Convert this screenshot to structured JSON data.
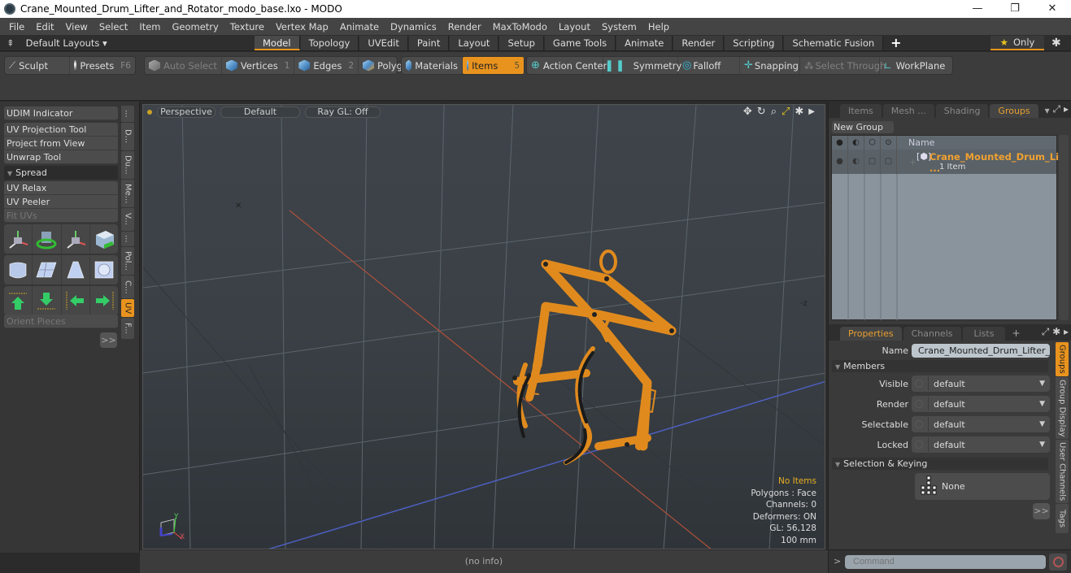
{
  "window": {
    "title": "Crane_Mounted_Drum_Lifter_and_Rotator_modo_base.lxo - MODO",
    "controls": {
      "minimize": "—",
      "maximize": "❐",
      "close": "✕"
    }
  },
  "menu": [
    "File",
    "Edit",
    "View",
    "Select",
    "Item",
    "Geometry",
    "Texture",
    "Vertex Map",
    "Animate",
    "Dynamics",
    "Render",
    "MaxToModo",
    "Layout",
    "System",
    "Help"
  ],
  "layoutbar": {
    "layouts_label": "Default Layouts ▾",
    "tabs": [
      {
        "label": "Model",
        "active": true
      },
      {
        "label": "Topology"
      },
      {
        "label": "UVEdit"
      },
      {
        "label": "Paint"
      },
      {
        "label": "Layout"
      },
      {
        "label": "Setup"
      },
      {
        "label": "Game Tools"
      },
      {
        "label": "Animate"
      },
      {
        "label": "Render"
      },
      {
        "label": "Scripting"
      },
      {
        "label": "Schematic Fusion"
      }
    ],
    "add_tab": "+",
    "only_label": "Only"
  },
  "toolbar": {
    "sculpt": "Sculpt",
    "presets": "Presets",
    "presets_key": "F6",
    "auto_select": "Auto Select",
    "vertices": "Vertices",
    "vertices_key": "1",
    "edges": "Edges",
    "edges_key": "2",
    "polygons": "Polygons",
    "materials": "Materials",
    "items": "Items",
    "items_key": "5",
    "action_center": "Action Center",
    "symmetry": "Symmetry",
    "falloff": "Falloff",
    "snapping": "Snapping",
    "select_through": "Select Through",
    "workplane": "WorkPlane"
  },
  "leftpanel": {
    "udim": "UDIM Indicator",
    "uv_projection": "UV Projection Tool",
    "project_from_view": "Project from View",
    "unwrap": "Unwrap Tool",
    "spread": "Spread",
    "uv_relax": "UV Relax",
    "uv_peeler": "UV Peeler",
    "fit_uvs": "Fit UVs",
    "orient_pieces": "Orient Pieces",
    "more": ">>",
    "vtabs": [
      "...",
      "D...",
      "Du...",
      "Me...",
      "V...",
      "...",
      "Pol...",
      "C...",
      "UV",
      "F..."
    ]
  },
  "viewport": {
    "view": "Perspective",
    "shading": "Default",
    "raygl": "Ray GL: Off",
    "stats": {
      "selection": "No Items",
      "polygons": "Polygons : Face",
      "channels": "Channels: 0",
      "deformers": "Deformers: ON",
      "gl": "GL: 56,128",
      "unit": "100 mm"
    },
    "axis_y": "Y",
    "axis_x": "X"
  },
  "infobar": "(no info)",
  "rightpanel": {
    "tabs": [
      {
        "label": "Items"
      },
      {
        "label": "Mesh ..."
      },
      {
        "label": "Shading"
      },
      {
        "label": "Groups",
        "active": true
      }
    ],
    "new_group": "New Group",
    "list_header": "Name",
    "group_item": {
      "name": "Crane_Mounted_Drum_Li ...",
      "count": "1 Item"
    },
    "prop_tabs": [
      {
        "label": "Properties",
        "active": true
      },
      {
        "label": "Channels"
      },
      {
        "label": "Lists"
      }
    ],
    "name_label": "Name",
    "name_value": "Crane_Mounted_Drum_Lifter_and",
    "members_section": "Members",
    "props": [
      {
        "label": "Visible",
        "value": "default"
      },
      {
        "label": "Render",
        "value": "default"
      },
      {
        "label": "Selectable",
        "value": "default"
      },
      {
        "label": "Locked",
        "value": "default"
      }
    ],
    "selection_section": "Selection & Keying",
    "none_label": "None",
    "more": ">>",
    "vtabs": [
      "Groups",
      "Group Display",
      "User Channels",
      "Tags"
    ],
    "command_placeholder": "Command"
  },
  "colors": {
    "accent": "#e8931e",
    "model_orange": "#e08a1e",
    "viewport_bg": "#3b4146"
  }
}
